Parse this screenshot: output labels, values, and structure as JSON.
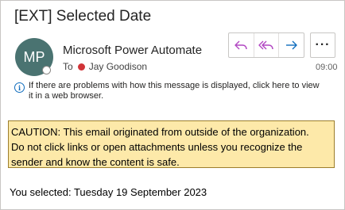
{
  "message": {
    "subject": "[EXT] Selected Date",
    "sender": {
      "name": "Microsoft Power Automate",
      "initials": "MP",
      "avatar_color": "#4a7371"
    },
    "to_label": "To",
    "recipient": {
      "name": "Jay Goodison",
      "presence_color": "#d13438"
    },
    "time": "09:00",
    "info_text": "If there are problems with how this message is displayed, click here to view it in a web browser.",
    "actions": {
      "reply_icon": "reply-icon",
      "reply_all_icon": "reply-all-icon",
      "forward_icon": "forward-icon",
      "more_label": "···"
    },
    "caution": {
      "lines": [
        "CAUTION: This email originated from outside of the organization.",
        "Do not click links or open attachments unless you recognize the",
        "sender and know the content is safe."
      ],
      "background": "#fde9a9"
    },
    "body_text": "You selected: Tuesday 19 September 2023"
  }
}
